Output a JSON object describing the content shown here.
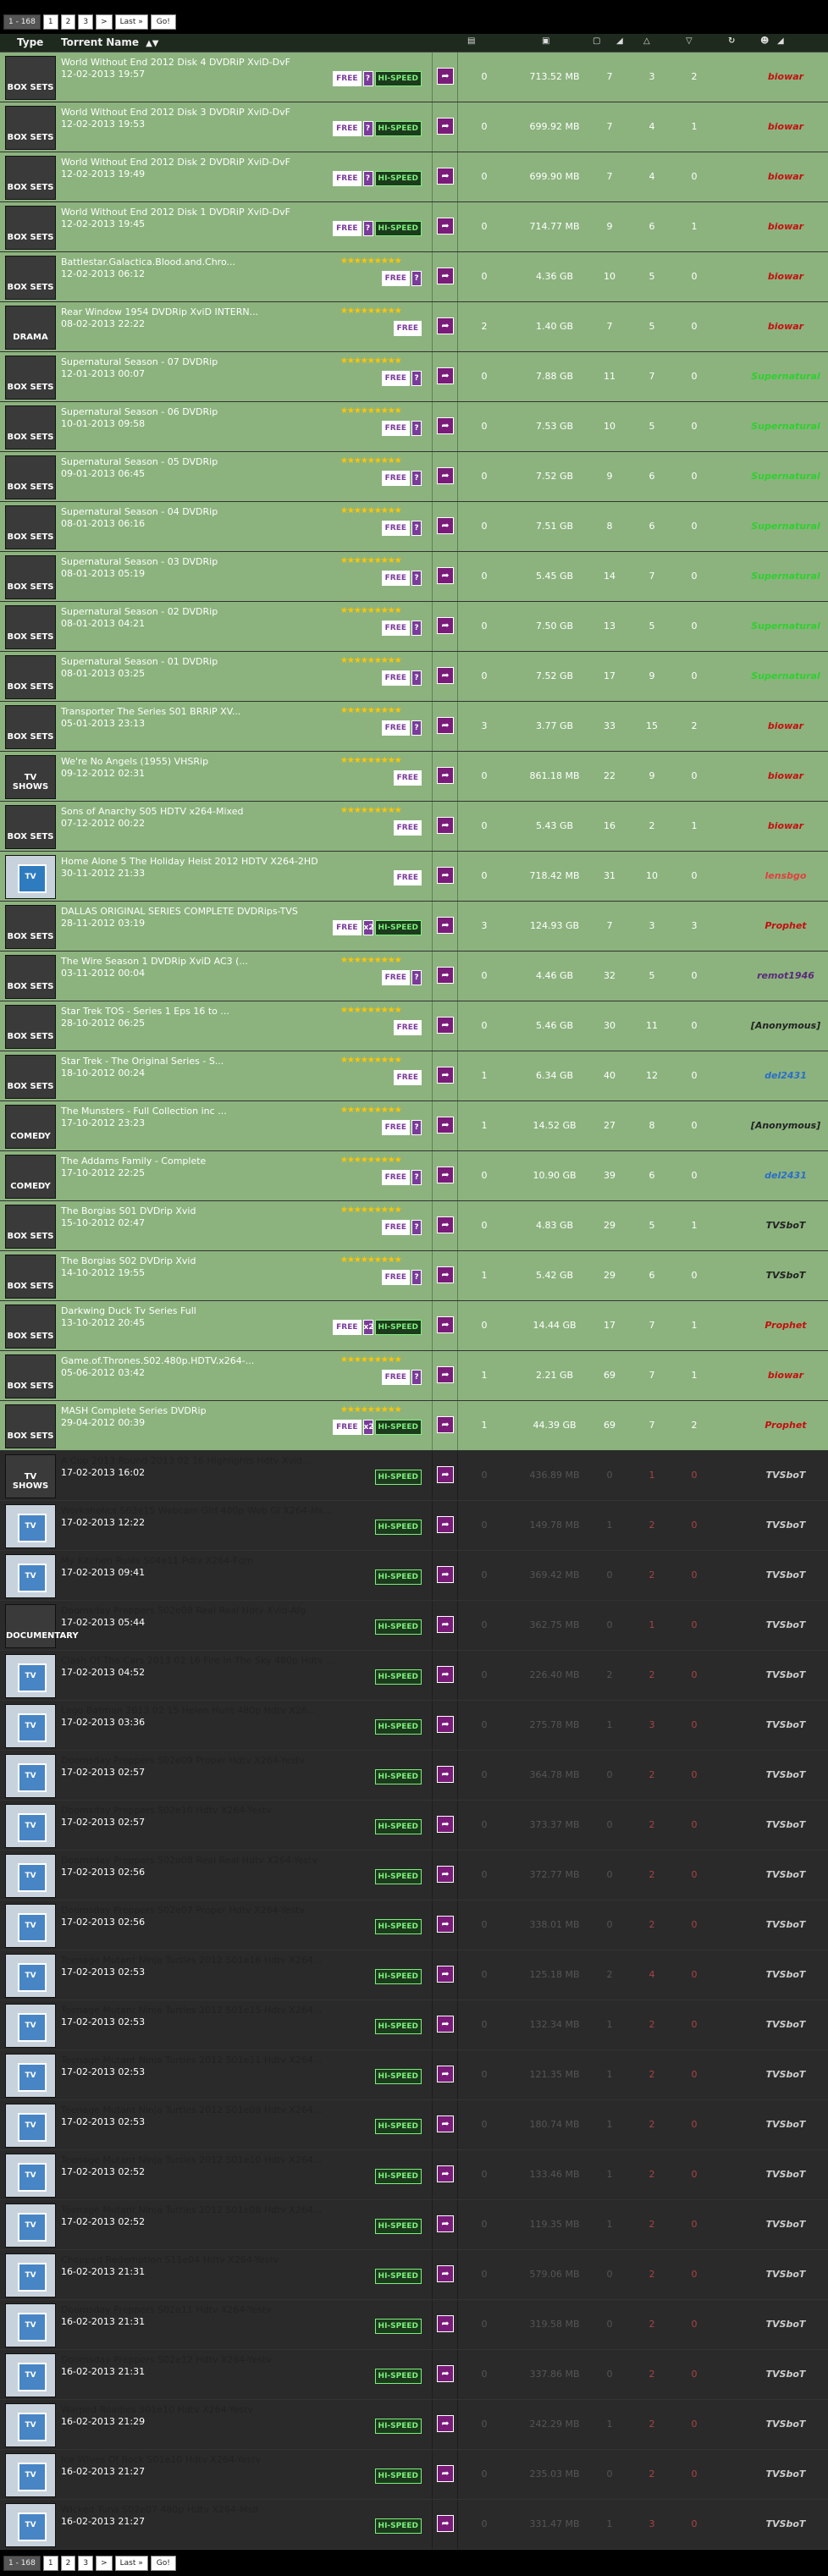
{
  "pager": [
    "1 - 168",
    "1",
    "2",
    "3",
    ">",
    "Last »",
    "Go!"
  ],
  "header": {
    "type": "Type",
    "name": "Torrent Name"
  },
  "rows": [
    {
      "title": "World Without End 2012 Disk 4 DVDRiP XviD-DvF",
      "date": "12-02-2013 19:57",
      "thumb": "BOX SETS",
      "stars": "",
      "badges": [
        "FREE",
        "?",
        "HI-SPEED"
      ],
      "comments": "0",
      "size": "713.52 MB",
      "files": "7",
      "seeders": "3",
      "leechers": "2",
      "uploader": "biowar",
      "uc": "#c41010",
      "style": "green"
    },
    {
      "title": "World Without End 2012 Disk 3 DVDRiP XviD-DvF",
      "date": "12-02-2013 19:53",
      "thumb": "BOX SETS",
      "stars": "",
      "badges": [
        "FREE",
        "?",
        "HI-SPEED"
      ],
      "comments": "0",
      "size": "699.92 MB",
      "files": "7",
      "seeders": "4",
      "leechers": "1",
      "uploader": "biowar",
      "uc": "#c41010",
      "style": "green"
    },
    {
      "title": "World Without End 2012 Disk 2 DVDRiP XviD-DvF",
      "date": "12-02-2013 19:49",
      "thumb": "BOX SETS",
      "stars": "",
      "badges": [
        "FREE",
        "?",
        "HI-SPEED"
      ],
      "comments": "0",
      "size": "699.90 MB",
      "files": "7",
      "seeders": "4",
      "leechers": "0",
      "uploader": "biowar",
      "uc": "#c41010",
      "style": "green"
    },
    {
      "title": "World Without End 2012 Disk 1 DVDRiP XviD-DvF",
      "date": "12-02-2013 19:45",
      "thumb": "BOX SETS",
      "stars": "",
      "badges": [
        "FREE",
        "?",
        "HI-SPEED"
      ],
      "comments": "0",
      "size": "714.77 MB",
      "files": "9",
      "seeders": "6",
      "leechers": "1",
      "uploader": "biowar",
      "uc": "#c41010",
      "style": "green"
    },
    {
      "title": "Battlestar.Galactica.Blood.and.Chro...",
      "date": "12-02-2013 06:12",
      "thumb": "BOX SETS",
      "stars": "★★★★★★★★★",
      "badges": [
        "FREE",
        "?"
      ],
      "comments": "0",
      "size": "4.36 GB",
      "files": "10",
      "seeders": "5",
      "leechers": "0",
      "uploader": "biowar",
      "uc": "#c41010",
      "style": "green"
    },
    {
      "title": "Rear Window 1954 DVDRip XviD INTERN...",
      "date": "08-02-2013 22:22",
      "thumb": "DRAMA",
      "stars": "★★★★★★★★★",
      "badges": [
        "FREE"
      ],
      "comments": "2",
      "size": "1.40 GB",
      "files": "7",
      "seeders": "5",
      "leechers": "0",
      "uploader": "biowar",
      "uc": "#c41010",
      "style": "green"
    },
    {
      "title": "Supernatural Season - 07 DVDRip",
      "date": "12-01-2013 00:07",
      "thumb": "BOX SETS",
      "stars": "★★★★★★★★★",
      "badges": [
        "FREE",
        "?"
      ],
      "comments": "0",
      "size": "7.88 GB",
      "files": "11",
      "seeders": "7",
      "leechers": "0",
      "uploader": "Supernatural",
      "uc": "#2fd02f",
      "style": "green"
    },
    {
      "title": "Supernatural Season - 06 DVDRip",
      "date": "10-01-2013 09:58",
      "thumb": "BOX SETS",
      "stars": "★★★★★★★★★",
      "badges": [
        "FREE",
        "?"
      ],
      "comments": "0",
      "size": "7.53 GB",
      "files": "10",
      "seeders": "5",
      "leechers": "0",
      "uploader": "Supernatural",
      "uc": "#2fd02f",
      "style": "green"
    },
    {
      "title": "Supernatural Season - 05 DVDRip",
      "date": "09-01-2013 06:45",
      "thumb": "BOX SETS",
      "stars": "★★★★★★★★★",
      "badges": [
        "FREE",
        "?"
      ],
      "comments": "0",
      "size": "7.52 GB",
      "files": "9",
      "seeders": "6",
      "leechers": "0",
      "uploader": "Supernatural",
      "uc": "#2fd02f",
      "style": "green"
    },
    {
      "title": "Supernatural Season - 04 DVDRip",
      "date": "08-01-2013 06:16",
      "thumb": "BOX SETS",
      "stars": "★★★★★★★★★",
      "badges": [
        "FREE",
        "?"
      ],
      "comments": "0",
      "size": "7.51 GB",
      "files": "8",
      "seeders": "6",
      "leechers": "0",
      "uploader": "Supernatural",
      "uc": "#2fd02f",
      "style": "green"
    },
    {
      "title": "Supernatural Season - 03 DVDRip",
      "date": "08-01-2013 05:19",
      "thumb": "BOX SETS",
      "stars": "★★★★★★★★★",
      "badges": [
        "FREE",
        "?"
      ],
      "comments": "0",
      "size": "5.45 GB",
      "files": "14",
      "seeders": "7",
      "leechers": "0",
      "uploader": "Supernatural",
      "uc": "#2fd02f",
      "style": "green"
    },
    {
      "title": "Supernatural Season - 02 DVDRip",
      "date": "08-01-2013 04:21",
      "thumb": "BOX SETS",
      "stars": "★★★★★★★★★",
      "badges": [
        "FREE",
        "?"
      ],
      "comments": "0",
      "size": "7.50 GB",
      "files": "13",
      "seeders": "5",
      "leechers": "0",
      "uploader": "Supernatural",
      "uc": "#2fd02f",
      "style": "green"
    },
    {
      "title": "Supernatural Season - 01 DVDRip",
      "date": "08-01-2013 03:25",
      "thumb": "BOX SETS",
      "stars": "★★★★★★★★★",
      "badges": [
        "FREE",
        "?"
      ],
      "comments": "0",
      "size": "7.52 GB",
      "files": "17",
      "seeders": "9",
      "leechers": "0",
      "uploader": "Supernatural",
      "uc": "#2fd02f",
      "style": "green"
    },
    {
      "title": "Transporter The Series S01 BRRiP XV...",
      "date": "05-01-2013 23:13",
      "thumb": "BOX SETS",
      "stars": "★★★★★★★★★",
      "badges": [
        "FREE",
        "?"
      ],
      "comments": "3",
      "size": "3.77 GB",
      "files": "33",
      "seeders": "15",
      "leechers": "2",
      "uploader": "biowar",
      "uc": "#c41010",
      "style": "green"
    },
    {
      "title": "We're No Angels (1955) VHSRip",
      "date": "09-12-2012 02:31",
      "thumb": "TV SHOWS",
      "stars": "★★★★★★★★★",
      "badges": [
        "FREE"
      ],
      "comments": "0",
      "size": "861.18 MB",
      "files": "22",
      "seeders": "9",
      "leechers": "0",
      "uploader": "biowar",
      "uc": "#c41010",
      "style": "green"
    },
    {
      "title": "Sons of Anarchy S05 HDTV x264-Mixed",
      "date": "07-12-2012 00:22",
      "thumb": "BOX SETS",
      "stars": "★★★★★★★★★",
      "badges": [
        "FREE"
      ],
      "comments": "0",
      "size": "5.43 GB",
      "files": "16",
      "seeders": "2",
      "leechers": "1",
      "uploader": "biowar",
      "uc": "#c41010",
      "style": "green"
    },
    {
      "title": "Home Alone 5 The Holiday Heist 2012 HDTV X264-2HD",
      "date": "30-11-2012 21:33",
      "thumb": "TV",
      "stars": "",
      "badges": [
        "FREE"
      ],
      "comments": "0",
      "size": "718.42 MB",
      "files": "31",
      "seeders": "10",
      "leechers": "0",
      "uploader": "lensbgo",
      "uc": "#e04040",
      "style": "green"
    },
    {
      "title": "DALLAS ORIGINAL SERIES COMPLETE DVDRips-TVS",
      "date": "28-11-2012 03:19",
      "thumb": "BOX SETS",
      "stars": "",
      "badges": [
        "FREE",
        "x2",
        "HI-SPEED"
      ],
      "comments": "3",
      "size": "124.93 GB",
      "files": "7",
      "seeders": "3",
      "leechers": "3",
      "uploader": "Prophet",
      "uc": "#c41010",
      "style": "green"
    },
    {
      "title": "The Wire Season 1 DVDRip XviD AC3 (...",
      "date": "03-11-2012 00:04",
      "thumb": "BOX SETS",
      "stars": "★★★★★★★★★",
      "badges": [
        "FREE",
        "?"
      ],
      "comments": "0",
      "size": "4.46 GB",
      "files": "32",
      "seeders": "5",
      "leechers": "0",
      "uploader": "remot1946",
      "uc": "#5a2a7a",
      "style": "green"
    },
    {
      "title": "Star Trek TOS - Series 1 Eps 16 to ...",
      "date": "28-10-2012 06:25",
      "thumb": "BOX SETS",
      "stars": "★★★★★★★★★",
      "badges": [
        "FREE"
      ],
      "comments": "0",
      "size": "5.46 GB",
      "files": "30",
      "seeders": "11",
      "leechers": "0",
      "uploader": "[Anonymous]",
      "uc": "#222",
      "style": "green"
    },
    {
      "title": "Star Trek - The Original Series - S...",
      "date": "18-10-2012 00:24",
      "thumb": "BOX SETS",
      "stars": "★★★★★★★★★",
      "badges": [
        "FREE"
      ],
      "comments": "1",
      "size": "6.34 GB",
      "files": "40",
      "seeders": "12",
      "leechers": "0",
      "uploader": "del2431",
      "uc": "#2a6ec8",
      "style": "green"
    },
    {
      "title": "The Munsters - Full Collection inc ...",
      "date": "17-10-2012 23:23",
      "thumb": "COMEDY",
      "stars": "★★★★★★★★★",
      "badges": [
        "FREE",
        "?"
      ],
      "comments": "1",
      "size": "14.52 GB",
      "files": "27",
      "seeders": "8",
      "leechers": "0",
      "uploader": "[Anonymous]",
      "uc": "#222",
      "style": "green"
    },
    {
      "title": "The Addams Family - Complete",
      "date": "17-10-2012 22:25",
      "thumb": "COMEDY",
      "stars": "★★★★★★★★★",
      "badges": [
        "FREE",
        "?"
      ],
      "comments": "0",
      "size": "10.90 GB",
      "files": "39",
      "seeders": "6",
      "leechers": "0",
      "uploader": "del2431",
      "uc": "#2a6ec8",
      "style": "green"
    },
    {
      "title": "The Borgias S01 DVDrip Xvid",
      "date": "15-10-2012 02:47",
      "thumb": "BOX SETS",
      "stars": "★★★★★★★★★",
      "badges": [
        "FREE",
        "?"
      ],
      "comments": "0",
      "size": "4.83 GB",
      "files": "29",
      "seeders": "5",
      "leechers": "1",
      "uploader": "TVSboT",
      "uc": "#222",
      "style": "green"
    },
    {
      "title": "The Borgias S02 DVDrip Xvid",
      "date": "14-10-2012 19:55",
      "thumb": "BOX SETS",
      "stars": "★★★★★★★★★",
      "badges": [
        "FREE",
        "?"
      ],
      "comments": "1",
      "size": "5.42 GB",
      "files": "29",
      "seeders": "6",
      "leechers": "0",
      "uploader": "TVSboT",
      "uc": "#222",
      "style": "green"
    },
    {
      "title": "Darkwing Duck Tv Series Full",
      "date": "13-10-2012 20:45",
      "thumb": "BOX SETS",
      "stars": "",
      "badges": [
        "FREE",
        "x2",
        "HI-SPEED"
      ],
      "comments": "0",
      "size": "14.44 GB",
      "files": "17",
      "seeders": "7",
      "leechers": "1",
      "uploader": "Prophet",
      "uc": "#c41010",
      "style": "green"
    },
    {
      "title": "Game.of.Thrones.S02.480p.HDTV.x264-...",
      "date": "05-06-2012 03:42",
      "thumb": "BOX SETS",
      "stars": "★★★★★★★★★",
      "badges": [
        "FREE",
        "?"
      ],
      "comments": "1",
      "size": "2.21 GB",
      "files": "69",
      "seeders": "7",
      "leechers": "1",
      "uploader": "biowar",
      "uc": "#c41010",
      "style": "green"
    },
    {
      "title": "MASH Complete Series DVDRip",
      "date": "29-04-2012 00:39",
      "thumb": "BOX SETS",
      "stars": "★★★★★★★★★",
      "badges": [
        "FREE",
        "x2",
        "HI-SPEED"
      ],
      "comments": "1",
      "size": "44.39 GB",
      "files": "69",
      "seeders": "7",
      "leechers": "2",
      "uploader": "Prophet",
      "uc": "#c41010",
      "style": "green"
    },
    {
      "title": "A Cup 2013 Round 2013 02 16 Highlights Hdtv Xvid...",
      "date": "17-02-2013 16:02",
      "thumb": "TV SHOWS",
      "stars": "",
      "badges": [
        "HI-SPEED"
      ],
      "comments": "0",
      "size": "436.89 MB",
      "files": "0",
      "seeders": "1",
      "leechers": "0",
      "uploader": "TVSboT",
      "uc": "#ccc",
      "style": "dark"
    },
    {
      "title": "Workaholics S03e15 Webcam Girl 480p Web Gl X264-Ms...",
      "date": "17-02-2013 12:22",
      "thumb": "TV",
      "stars": "",
      "badges": [
        "HI-SPEED"
      ],
      "comments": "0",
      "size": "149.78 MB",
      "files": "1",
      "seeders": "2",
      "leechers": "0",
      "uploader": "TVSboT",
      "uc": "#ccc",
      "style": "dark"
    },
    {
      "title": "My Kitchen Rules S04e11 Pdtv X264-Fqm",
      "date": "17-02-2013 09:41",
      "thumb": "TV",
      "stars": "",
      "badges": [
        "HI-SPEED"
      ],
      "comments": "0",
      "size": "369.42 MB",
      "files": "0",
      "seeders": "2",
      "leechers": "0",
      "uploader": "TVSboT",
      "uc": "#ccc",
      "style": "dark"
    },
    {
      "title": "Doomsday Preppers S02e08 Real Real Hdtv Xvid-Afg",
      "date": "17-02-2013 05:44",
      "thumb": "DOCUMENTARY",
      "stars": "",
      "badges": [
        "HI-SPEED"
      ],
      "comments": "0",
      "size": "362.75 MB",
      "files": "0",
      "seeders": "1",
      "leechers": "0",
      "uploader": "TVSboT",
      "uc": "#ccc",
      "style": "dark"
    },
    {
      "title": "Clash Of The Cars 2013 02 16 Fire In The Sky 480p Hdtv ...",
      "date": "17-02-2013 04:52",
      "thumb": "TV",
      "stars": "",
      "badges": [
        "HI-SPEED"
      ],
      "comments": "0",
      "size": "226.40 MB",
      "files": "2",
      "seeders": "2",
      "leechers": "0",
      "uploader": "TVSboT",
      "uc": "#ccc",
      "style": "dark"
    },
    {
      "title": "Lego Batman 2013 02 15 Helen Hunt 480p Hdtv X26...",
      "date": "17-02-2013 03:36",
      "thumb": "TV",
      "stars": "",
      "badges": [
        "HI-SPEED"
      ],
      "comments": "0",
      "size": "275.78 MB",
      "files": "1",
      "seeders": "3",
      "leechers": "0",
      "uploader": "TVSboT",
      "uc": "#ccc",
      "style": "dark"
    },
    {
      "title": "Doomsday Preppers S02e09 Proper Hdtv X264-Yestv",
      "date": "17-02-2013 02:57",
      "thumb": "TV",
      "stars": "",
      "badges": [
        "HI-SPEED"
      ],
      "comments": "0",
      "size": "364.78 MB",
      "files": "0",
      "seeders": "2",
      "leechers": "0",
      "uploader": "TVSboT",
      "uc": "#ccc",
      "style": "dark"
    },
    {
      "title": "Doomsday Preppers S02e10 Hdtv X264-Yestv",
      "date": "17-02-2013 02:57",
      "thumb": "TV",
      "stars": "",
      "badges": [
        "HI-SPEED"
      ],
      "comments": "0",
      "size": "373.37 MB",
      "files": "0",
      "seeders": "2",
      "leechers": "0",
      "uploader": "TVSboT",
      "uc": "#ccc",
      "style": "dark"
    },
    {
      "title": "Doomsday Preppers S02e08 Real Real Hdtv X264-Yestv",
      "date": "17-02-2013 02:56",
      "thumb": "TV",
      "stars": "",
      "badges": [
        "HI-SPEED"
      ],
      "comments": "0",
      "size": "372.77 MB",
      "files": "0",
      "seeders": "2",
      "leechers": "0",
      "uploader": "TVSboT",
      "uc": "#ccc",
      "style": "dark"
    },
    {
      "title": "Doomsday Preppers S02e07 Proper Hdtv X264-Yestv",
      "date": "17-02-2013 02:56",
      "thumb": "TV",
      "stars": "",
      "badges": [
        "HI-SPEED"
      ],
      "comments": "0",
      "size": "338.01 MB",
      "files": "0",
      "seeders": "2",
      "leechers": "0",
      "uploader": "TVSboT",
      "uc": "#ccc",
      "style": "dark"
    },
    {
      "title": "Teenage Mutant Ninja Turtles 2012 S01e16 Hdtv X264...",
      "date": "17-02-2013 02:53",
      "thumb": "TV",
      "stars": "",
      "badges": [
        "HI-SPEED"
      ],
      "comments": "0",
      "size": "125.18 MB",
      "files": "2",
      "seeders": "4",
      "leechers": "0",
      "uploader": "TVSboT",
      "uc": "#ccc",
      "style": "dark"
    },
    {
      "title": "Teenage Mutant Ninja Turtles 2012 S01e15 Hdtv X264...",
      "date": "17-02-2013 02:53",
      "thumb": "TV",
      "stars": "",
      "badges": [
        "HI-SPEED"
      ],
      "comments": "0",
      "size": "132.34 MB",
      "files": "1",
      "seeders": "2",
      "leechers": "0",
      "uploader": "TVSboT",
      "uc": "#ccc",
      "style": "dark"
    },
    {
      "title": "Teenage Mutant Ninja Turtles 2012 S01e11 Hdtv X264...",
      "date": "17-02-2013 02:53",
      "thumb": "TV",
      "stars": "",
      "badges": [
        "HI-SPEED"
      ],
      "comments": "0",
      "size": "121.35 MB",
      "files": "1",
      "seeders": "2",
      "leechers": "0",
      "uploader": "TVSboT",
      "uc": "#ccc",
      "style": "dark"
    },
    {
      "title": "Teenage Mutant Ninja Turtles 2012 S01e09 Hdtv X264...",
      "date": "17-02-2013 02:53",
      "thumb": "TV",
      "stars": "",
      "badges": [
        "HI-SPEED"
      ],
      "comments": "0",
      "size": "180.74 MB",
      "files": "1",
      "seeders": "2",
      "leechers": "0",
      "uploader": "TVSboT",
      "uc": "#ccc",
      "style": "dark"
    },
    {
      "title": "Teenage Mutant Ninja Turtles 2012 S01e10 Hdtv X264...",
      "date": "17-02-2013 02:52",
      "thumb": "TV",
      "stars": "",
      "badges": [
        "HI-SPEED"
      ],
      "comments": "0",
      "size": "133.46 MB",
      "files": "1",
      "seeders": "2",
      "leechers": "0",
      "uploader": "TVSboT",
      "uc": "#ccc",
      "style": "dark"
    },
    {
      "title": "Teenage Mutant Ninja Turtles 2012 S01e08 Hdtv X264...",
      "date": "17-02-2013 02:52",
      "thumb": "TV",
      "stars": "",
      "badges": [
        "HI-SPEED"
      ],
      "comments": "0",
      "size": "119.35 MB",
      "files": "1",
      "seeders": "2",
      "leechers": "0",
      "uploader": "TVSboT",
      "uc": "#ccc",
      "style": "dark"
    },
    {
      "title": "Chopped Redemption S11e04 Hdtv X264-Yestv",
      "date": "16-02-2013 21:31",
      "thumb": "TV",
      "stars": "",
      "badges": [
        "HI-SPEED"
      ],
      "comments": "0",
      "size": "579.06 MB",
      "files": "0",
      "seeders": "2",
      "leechers": "0",
      "uploader": "TVSboT",
      "uc": "#ccc",
      "style": "dark"
    },
    {
      "title": "Doomsday Preppers S02e11 Hdtv X264-Yestv",
      "date": "16-02-2013 21:31",
      "thumb": "TV",
      "stars": "",
      "badges": [
        "HI-SPEED"
      ],
      "comments": "0",
      "size": "319.58 MB",
      "files": "0",
      "seeders": "2",
      "leechers": "0",
      "uploader": "TVSboT",
      "uc": "#ccc",
      "style": "dark"
    },
    {
      "title": "Doomsday Preppers S02e12 Hdtv X264-Yestv",
      "date": "16-02-2013 21:31",
      "thumb": "TV",
      "stars": "",
      "badges": [
        "HI-SPEED"
      ],
      "comments": "0",
      "size": "337.86 MB",
      "files": "0",
      "seeders": "2",
      "leechers": "0",
      "uploader": "TVSboT",
      "uc": "#ccc",
      "style": "dark"
    },
    {
      "title": "Warped Roadies S01e10 Hdtv X264-Yestv",
      "date": "16-02-2013 21:29",
      "thumb": "TV",
      "stars": "",
      "badges": [
        "HI-SPEED"
      ],
      "comments": "0",
      "size": "242.29 MB",
      "files": "1",
      "seeders": "2",
      "leechers": "0",
      "uploader": "TVSboT",
      "uc": "#ccc",
      "style": "dark"
    },
    {
      "title": "Ice Wives Of Rock S01e10 Hdtv X264-Yestv",
      "date": "16-02-2013 21:27",
      "thumb": "TV",
      "stars": "",
      "badges": [
        "HI-SPEED"
      ],
      "comments": "0",
      "size": "235.03 MB",
      "files": "0",
      "seeders": "2",
      "leechers": "0",
      "uploader": "TVSboT",
      "uc": "#ccc",
      "style": "dark"
    },
    {
      "title": "Wicked Tuna S02e07 480p Hdtv X264-Msd",
      "date": "16-02-2013 21:27",
      "thumb": "TV",
      "stars": "",
      "badges": [
        "HI-SPEED"
      ],
      "comments": "0",
      "size": "331.47 MB",
      "files": "1",
      "seeders": "3",
      "leechers": "0",
      "uploader": "TVSboT",
      "uc": "#ccc",
      "style": "dark"
    }
  ]
}
